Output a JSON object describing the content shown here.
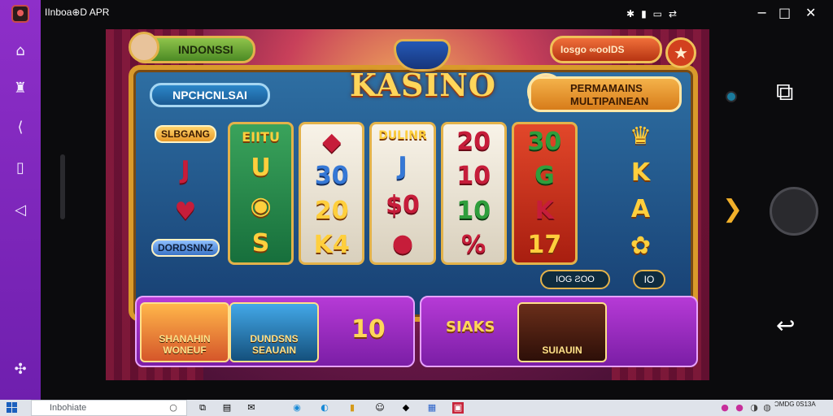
{
  "window": {
    "title": "IInboa⊕D APR",
    "status_icons": [
      "bluetooth-icon",
      "signal-icon",
      "battery-icon",
      "toggle-icon"
    ],
    "status_glyphs": [
      "✱",
      "▮",
      "▭",
      "⇄"
    ],
    "controls": [
      "minimize-icon",
      "maximize-icon",
      "close-icon"
    ],
    "control_glyphs": [
      "−",
      "□",
      "✕"
    ]
  },
  "left_bar": {
    "icons": [
      "home-icon",
      "profile-icon",
      "share-icon",
      "book-icon",
      "volume-icon",
      "settings-icon"
    ],
    "glyphs": [
      "⌂",
      "♜",
      "⟨",
      "▯",
      "◁",
      "✣"
    ]
  },
  "game": {
    "lang_label": "INDONSSI",
    "logo": "KASINO",
    "coin_label": "Iosgo ∞ooIDS",
    "player_label": "NPCHCNLSAI",
    "mp_line1": "PERMAMAINS",
    "mp_line2": "MULTIPAINEAN",
    "left_column": {
      "top_label": "SLBGANG",
      "symbols": [
        "J",
        "♥"
      ],
      "bottom_label": "DORDSNNZ"
    },
    "reels": [
      {
        "color": "green",
        "symbols": [
          "EIITU",
          "U",
          "◉",
          "S"
        ]
      },
      {
        "color": "white",
        "symbols": [
          "◆",
          "30",
          "20",
          "K4"
        ]
      },
      {
        "color": "white",
        "symbols": [
          "DULINR",
          "J",
          "$0",
          "●"
        ]
      },
      {
        "color": "white",
        "symbols": [
          "20",
          "10",
          "10",
          "%"
        ]
      },
      {
        "color": "red",
        "symbols": [
          "30",
          "G",
          "K",
          "17"
        ]
      }
    ],
    "right_column": {
      "symbols": [
        "♛",
        "K",
        "A",
        "✿"
      ]
    },
    "total_label": "IOG ƧOO",
    "bet_label": "IO",
    "tray": {
      "cards": [
        {
          "label": "SHANAHIN WONEUF"
        },
        {
          "label": "DUNDSNS SEAUAIN"
        },
        {
          "label": "10"
        },
        {
          "label": "SIAKS"
        },
        {
          "label": "SUIAUIN"
        }
      ]
    }
  },
  "right_nav": {
    "icons": [
      "recent-apps-icon",
      "home-button-icon",
      "back-icon",
      "forward-chevron-icon"
    ],
    "glyphs": [
      "⧉",
      "",
      "↩",
      "❯"
    ]
  },
  "taskbar": {
    "search_placeholder": "Inbohiate",
    "tray_text": "ƆMDG 0S13A"
  }
}
